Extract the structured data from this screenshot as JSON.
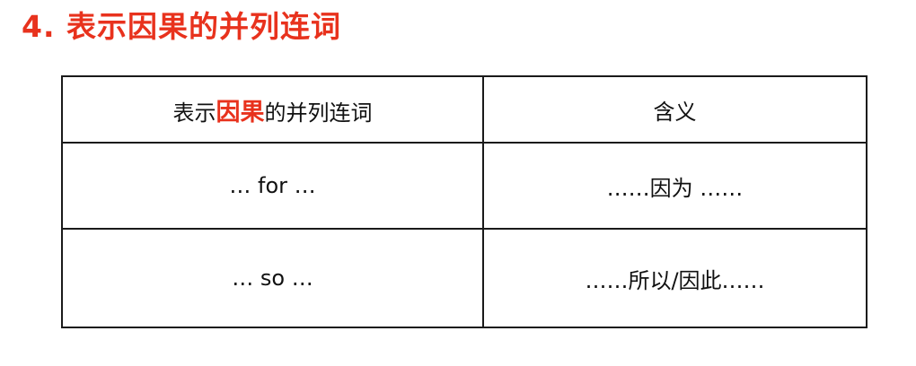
{
  "heading": {
    "number": "4.",
    "title": "表示因果的并列连词",
    "color": "#e8321d"
  },
  "table": {
    "header": {
      "col1_prefix": "表示",
      "col1_highlight": "因果",
      "col1_suffix": "的并列连词",
      "col2": "含义"
    },
    "rows": [
      {
        "conjunction": "… for …",
        "meaning": "……因为 ……"
      },
      {
        "conjunction": "… so …",
        "meaning": "……所以/因此……"
      }
    ]
  }
}
